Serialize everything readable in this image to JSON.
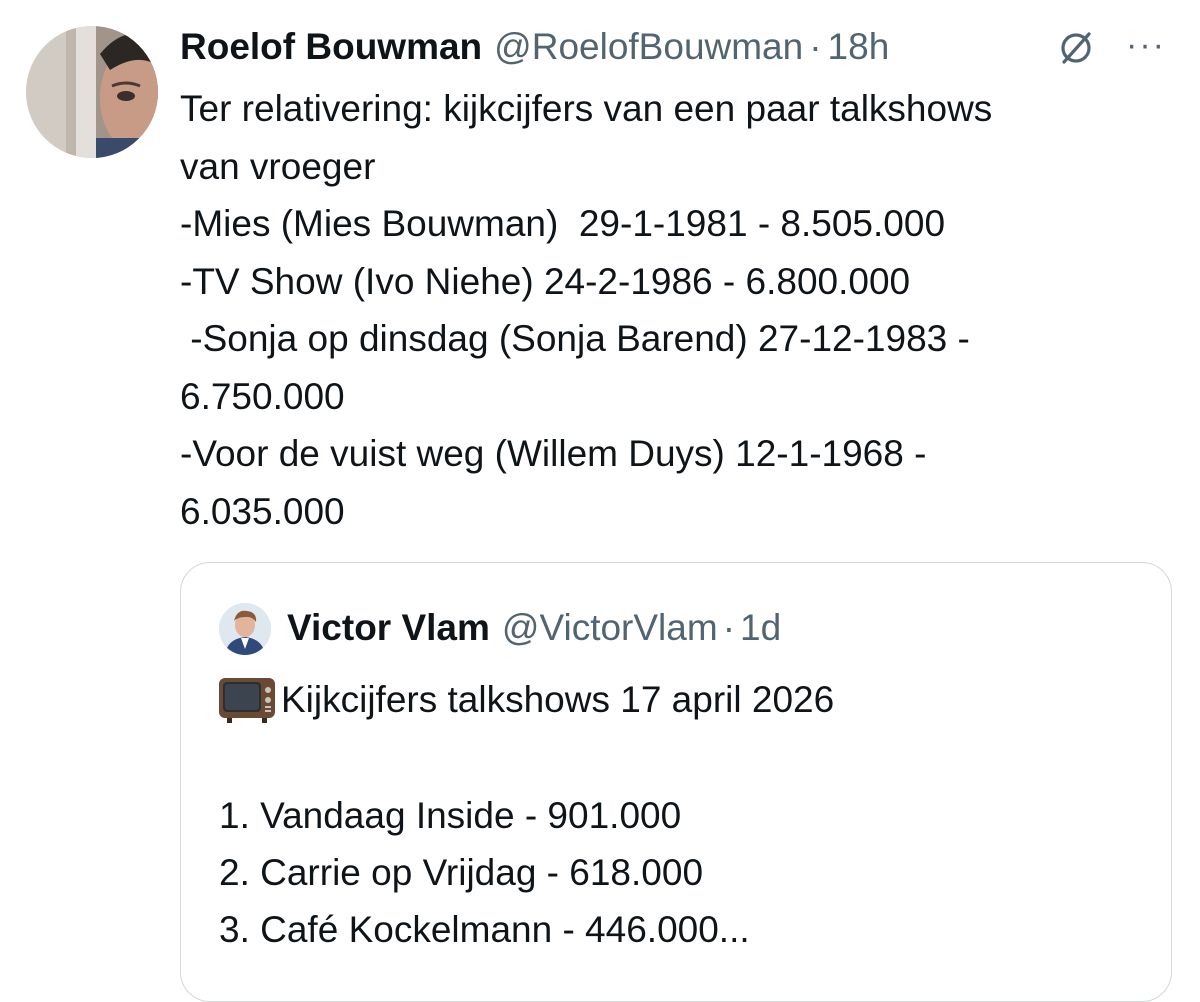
{
  "tweet": {
    "author_name": "Roelof Bouwman",
    "author_handle": "@RoelofBouwman",
    "separator": "·",
    "time": "18h",
    "grok_icon": "grok-icon",
    "more_icon": "more-horizontal-icon",
    "more_symbol": "···",
    "text_lines": [
      "Ter relativering: kijkcijfers van een paar talkshows",
      "van vroeger",
      "-Mies (Mies Bouwman)  29-1-1981 - 8.505.000",
      "-TV Show (Ivo Niehe) 24-2-1986 - 6.800.000",
      " -Sonja op dinsdag (Sonja Barend) 27-12-1983 -",
      "6.750.000",
      "-Voor de vuist weg (Willem Duys) 12-1-1968 -",
      "6.035.000"
    ]
  },
  "quoted_tweet": {
    "author_name": "Victor Vlam",
    "author_handle": "@VictorVlam",
    "separator": "·",
    "time": "1d",
    "title_icon": "television-icon",
    "title": "Kijkcijfers talkshows 17 april 2026",
    "list_items": [
      "1. Vandaag Inside - 901.000",
      "2. Carrie op Vrijdag - 618.000",
      "3. Café Kockelmann - 446.000..."
    ]
  },
  "colors": {
    "text_primary": "#0f1419",
    "text_secondary": "#536471",
    "border": "#cfd9de",
    "background": "#ffffff"
  }
}
